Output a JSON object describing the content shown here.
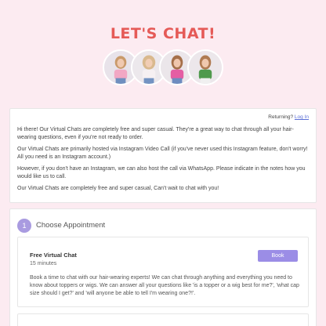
{
  "header": {
    "title": "LET'S CHAT!"
  },
  "intro": {
    "returning_text": "Returning?",
    "login_link": "Log In",
    "paragraphs": [
      "Hi there! Our Virtual Chats are completely free and super casual. They're a great way to chat through all your hair-wearing questions, even if you're not ready to order.",
      "Our Virtual Chats are primarily hosted via Instagram Video Call (if you've never used this Instagram feature, don't worry! All you need is an Instagram account.)",
      "However, if you don't have an Instagram, we can also host the call via WhatsApp. Please indicate in the notes how you would like us to call.",
      "Our Virtual Chats are completely free and super casual, Can't wait to chat with you!"
    ]
  },
  "step": {
    "number": "1",
    "title": "Choose Appointment"
  },
  "appointment": {
    "name": "Free Virtual Chat",
    "duration": "15 minutes",
    "book_label": "Book",
    "description": "Book a time to chat with our hair-wearing experts! We can chat through anything and everything you need to know about toppers or wigs. We can answer all your questions like 'is a topper or a wig best for me?', 'what cap size should I get?' and 'will anyone be able to tell I'm wearing one?!'."
  },
  "colors": {
    "background": "#fcebf1",
    "title": "#e55a57",
    "accent": "#9b8de6",
    "link": "#5b6fd6"
  }
}
